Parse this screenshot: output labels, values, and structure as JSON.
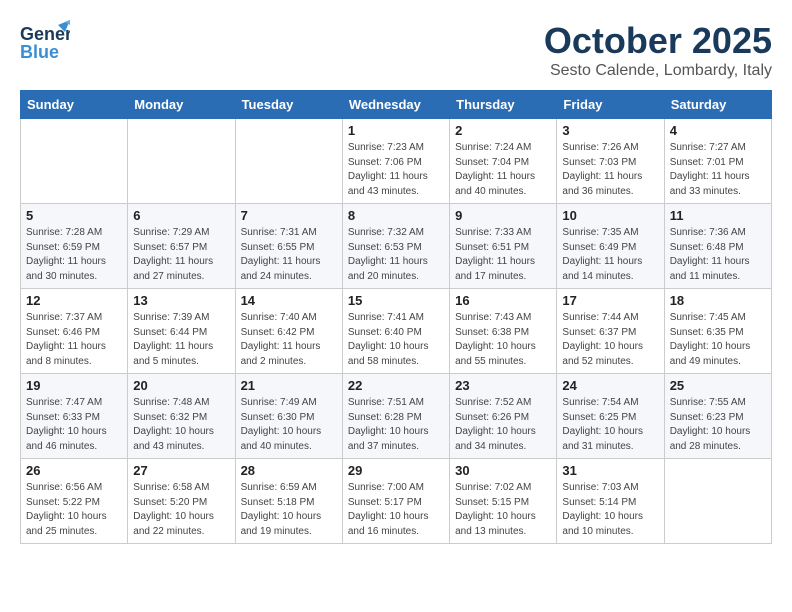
{
  "header": {
    "logo_general": "General",
    "logo_blue": "Blue",
    "month_title": "October 2025",
    "location": "Sesto Calende, Lombardy, Italy"
  },
  "days_of_week": [
    "Sunday",
    "Monday",
    "Tuesday",
    "Wednesday",
    "Thursday",
    "Friday",
    "Saturday"
  ],
  "weeks": [
    [
      {
        "day": "",
        "info": ""
      },
      {
        "day": "",
        "info": ""
      },
      {
        "day": "",
        "info": ""
      },
      {
        "day": "1",
        "info": "Sunrise: 7:23 AM\nSunset: 7:06 PM\nDaylight: 11 hours and 43 minutes."
      },
      {
        "day": "2",
        "info": "Sunrise: 7:24 AM\nSunset: 7:04 PM\nDaylight: 11 hours and 40 minutes."
      },
      {
        "day": "3",
        "info": "Sunrise: 7:26 AM\nSunset: 7:03 PM\nDaylight: 11 hours and 36 minutes."
      },
      {
        "day": "4",
        "info": "Sunrise: 7:27 AM\nSunset: 7:01 PM\nDaylight: 11 hours and 33 minutes."
      }
    ],
    [
      {
        "day": "5",
        "info": "Sunrise: 7:28 AM\nSunset: 6:59 PM\nDaylight: 11 hours and 30 minutes."
      },
      {
        "day": "6",
        "info": "Sunrise: 7:29 AM\nSunset: 6:57 PM\nDaylight: 11 hours and 27 minutes."
      },
      {
        "day": "7",
        "info": "Sunrise: 7:31 AM\nSunset: 6:55 PM\nDaylight: 11 hours and 24 minutes."
      },
      {
        "day": "8",
        "info": "Sunrise: 7:32 AM\nSunset: 6:53 PM\nDaylight: 11 hours and 20 minutes."
      },
      {
        "day": "9",
        "info": "Sunrise: 7:33 AM\nSunset: 6:51 PM\nDaylight: 11 hours and 17 minutes."
      },
      {
        "day": "10",
        "info": "Sunrise: 7:35 AM\nSunset: 6:49 PM\nDaylight: 11 hours and 14 minutes."
      },
      {
        "day": "11",
        "info": "Sunrise: 7:36 AM\nSunset: 6:48 PM\nDaylight: 11 hours and 11 minutes."
      }
    ],
    [
      {
        "day": "12",
        "info": "Sunrise: 7:37 AM\nSunset: 6:46 PM\nDaylight: 11 hours and 8 minutes."
      },
      {
        "day": "13",
        "info": "Sunrise: 7:39 AM\nSunset: 6:44 PM\nDaylight: 11 hours and 5 minutes."
      },
      {
        "day": "14",
        "info": "Sunrise: 7:40 AM\nSunset: 6:42 PM\nDaylight: 11 hours and 2 minutes."
      },
      {
        "day": "15",
        "info": "Sunrise: 7:41 AM\nSunset: 6:40 PM\nDaylight: 10 hours and 58 minutes."
      },
      {
        "day": "16",
        "info": "Sunrise: 7:43 AM\nSunset: 6:38 PM\nDaylight: 10 hours and 55 minutes."
      },
      {
        "day": "17",
        "info": "Sunrise: 7:44 AM\nSunset: 6:37 PM\nDaylight: 10 hours and 52 minutes."
      },
      {
        "day": "18",
        "info": "Sunrise: 7:45 AM\nSunset: 6:35 PM\nDaylight: 10 hours and 49 minutes."
      }
    ],
    [
      {
        "day": "19",
        "info": "Sunrise: 7:47 AM\nSunset: 6:33 PM\nDaylight: 10 hours and 46 minutes."
      },
      {
        "day": "20",
        "info": "Sunrise: 7:48 AM\nSunset: 6:32 PM\nDaylight: 10 hours and 43 minutes."
      },
      {
        "day": "21",
        "info": "Sunrise: 7:49 AM\nSunset: 6:30 PM\nDaylight: 10 hours and 40 minutes."
      },
      {
        "day": "22",
        "info": "Sunrise: 7:51 AM\nSunset: 6:28 PM\nDaylight: 10 hours and 37 minutes."
      },
      {
        "day": "23",
        "info": "Sunrise: 7:52 AM\nSunset: 6:26 PM\nDaylight: 10 hours and 34 minutes."
      },
      {
        "day": "24",
        "info": "Sunrise: 7:54 AM\nSunset: 6:25 PM\nDaylight: 10 hours and 31 minutes."
      },
      {
        "day": "25",
        "info": "Sunrise: 7:55 AM\nSunset: 6:23 PM\nDaylight: 10 hours and 28 minutes."
      }
    ],
    [
      {
        "day": "26",
        "info": "Sunrise: 6:56 AM\nSunset: 5:22 PM\nDaylight: 10 hours and 25 minutes."
      },
      {
        "day": "27",
        "info": "Sunrise: 6:58 AM\nSunset: 5:20 PM\nDaylight: 10 hours and 22 minutes."
      },
      {
        "day": "28",
        "info": "Sunrise: 6:59 AM\nSunset: 5:18 PM\nDaylight: 10 hours and 19 minutes."
      },
      {
        "day": "29",
        "info": "Sunrise: 7:00 AM\nSunset: 5:17 PM\nDaylight: 10 hours and 16 minutes."
      },
      {
        "day": "30",
        "info": "Sunrise: 7:02 AM\nSunset: 5:15 PM\nDaylight: 10 hours and 13 minutes."
      },
      {
        "day": "31",
        "info": "Sunrise: 7:03 AM\nSunset: 5:14 PM\nDaylight: 10 hours and 10 minutes."
      },
      {
        "day": "",
        "info": ""
      }
    ]
  ]
}
